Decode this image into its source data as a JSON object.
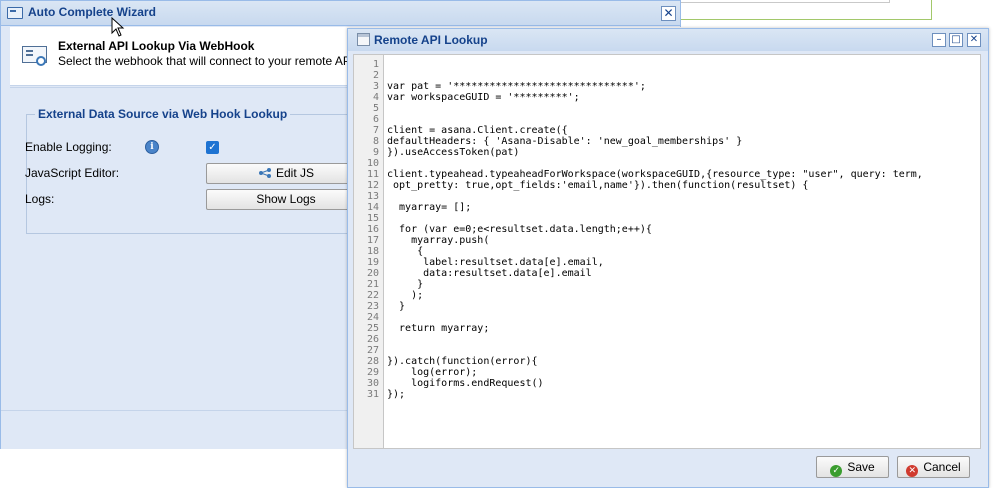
{
  "wizard": {
    "title": "Auto Complete Wizard",
    "close_glyph": "✕",
    "header_title": "External API Lookup Via WebHook",
    "header_subtitle": "Select the webhook that will connect to your remote API and",
    "header_icon": "lookup-icon",
    "fieldset_title": "External Data Source via Web Hook Lookup",
    "fields": {
      "logging_label": "Enable Logging:",
      "logging_checked": true,
      "editor_label": "JavaScript Editor:",
      "editor_button": "Edit JS",
      "logs_label": "Logs:",
      "logs_button": "Show Logs"
    }
  },
  "dialog": {
    "title": "Remote API Lookup",
    "min_glyph": "–",
    "max_glyph": "□",
    "close_glyph": "✕",
    "line_numbers": [
      "1",
      "2",
      "3",
      "4",
      "5",
      "6",
      "7",
      "8",
      "9",
      "10",
      "11",
      "12",
      "13",
      "14",
      "15",
      "16",
      "17",
      "18",
      "19",
      "20",
      "21",
      "22",
      "23",
      "24",
      "25",
      "26",
      "27",
      "28",
      "29",
      "30",
      "31"
    ],
    "code_lines": [
      "",
      "",
      "var pat = '******************************';",
      "var workspaceGUID = '*********';",
      "",
      "",
      "client = asana.Client.create({",
      "defaultHeaders: { 'Asana-Disable': 'new_goal_memberships' }",
      "}).useAccessToken(pat)",
      "",
      "client.typeahead.typeaheadForWorkspace(workspaceGUID,{resource_type: \"user\", query: term,",
      " opt_pretty: true,opt_fields:'email,name'}).then(function(resultset) {",
      "",
      "  myarray= [];",
      "",
      "  for (var e=0;e<resultset.data.length;e++){",
      "    myarray.push(",
      "     {",
      "      label:resultset.data[e].email,",
      "      data:resultset.data[e].email",
      "     }",
      "    );",
      "  }",
      "",
      "  return myarray;",
      "",
      "",
      "}).catch(function(error){",
      "    log(error);",
      "    logiforms.endRequest()",
      "});"
    ],
    "save_label": "Save",
    "cancel_label": "Cancel"
  },
  "colors": {
    "title_text": "#15428b",
    "window_bg": "#dfe8f6",
    "save_icon": "#3a9d2f",
    "cancel_icon": "#d03a2e"
  }
}
